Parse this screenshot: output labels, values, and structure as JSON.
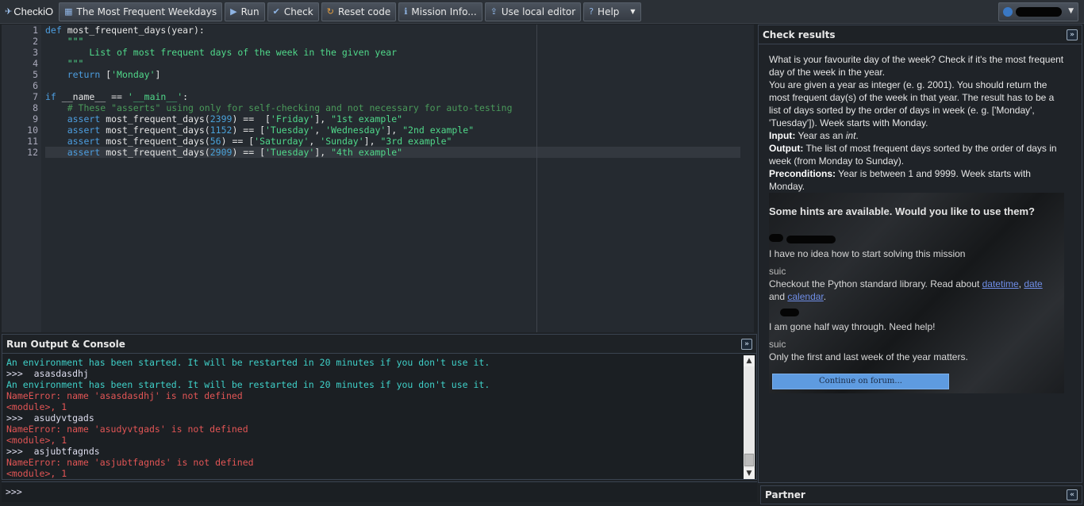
{
  "toolbar": {
    "logo": "CheckiO",
    "mission_tab": "The Most Frequent Weekdays",
    "run": "Run",
    "check": "Check",
    "reset": "Reset code",
    "mission_info": "Mission Info...",
    "local_editor": "Use local editor",
    "help": "Help"
  },
  "editor": {
    "line_numbers": [
      "1",
      "2",
      "3",
      "4",
      "5",
      "6",
      "7",
      "8",
      "9",
      "10",
      "11",
      "12"
    ]
  },
  "console": {
    "title": "Run Output & Console",
    "lines": [
      {
        "type": "info",
        "text": "An environment has been started. It will be restarted in 20 minutes if you don't use it."
      },
      {
        "type": "cmd",
        "text": ">>>  asasdasdhj"
      },
      {
        "type": "info",
        "text": "An environment has been started. It will be restarted in 20 minutes if you don't use it."
      },
      {
        "type": "err",
        "text": "NameError: name 'asasdasdhj' is not defined"
      },
      {
        "type": "err",
        "text": "<module>, 1"
      },
      {
        "type": "cmd",
        "text": ">>>  asudyvtgads"
      },
      {
        "type": "err",
        "text": "NameError: name 'asudyvtgads' is not defined"
      },
      {
        "type": "err",
        "text": "<module>, 1"
      },
      {
        "type": "cmd",
        "text": ">>>  asjubtfagnds"
      },
      {
        "type": "err",
        "text": "NameError: name 'asjubtfagnds' is not defined"
      },
      {
        "type": "err",
        "text": "<module>, 1"
      }
    ],
    "prompt": ">>>"
  },
  "check_results": {
    "title": "Check results",
    "p1": "What is your favourite day of the week? Check if it's the most frequent day of the week in the year.",
    "p2": "You are given a year as integer (e. g. 2001). You should return the most frequent day(s) of the week in that year. The result has to be a list of days sorted by the order of days in week (e. g. ['Monday', 'Tuesday']). Week starts with Monday.",
    "input_label": "Input:",
    "input_text": "Year as an",
    "input_type": "int",
    "input_end": ".",
    "output_label": "Output:",
    "output_text": "The list of most frequent days sorted by the order of days in week (from Monday to Sunday).",
    "pre_label": "Preconditions:",
    "pre_text": "Year is between 1 and 9999. Week starts with Monday."
  },
  "hints": {
    "title": "Some hints are available. Would you like to use them?",
    "q1": "I have no idea how to start solving this mission",
    "a1_user": "suic",
    "a1_text": "Checkout the Python standard library. Read about",
    "a1_link1": "datetime",
    "a1_sep": ",",
    "a1_link2": "date",
    "a1_and": "and",
    "a1_link3": "calendar",
    "a1_end": ".",
    "q2": "I am gone half way through. Need help!",
    "a2_user": "suic",
    "a2_text": "Only the first and last week of the year matters.",
    "forum_button": "Continue on forum..."
  },
  "partner": {
    "title": "Partner"
  }
}
